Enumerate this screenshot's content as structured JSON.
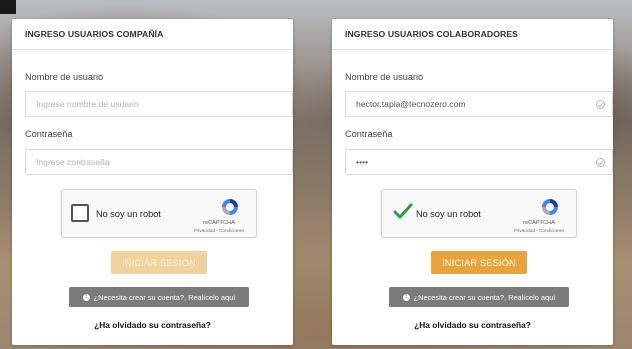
{
  "corner_badge": "",
  "company_panel": {
    "title": "INGRESO USUARIOS COMPAÑÍA",
    "username_label": "Nombre de usuario",
    "username_placeholder": "Ingrese nombre de usuario",
    "username_value": "",
    "password_label": "Contraseña",
    "password_placeholder": "Ingrese contraseña",
    "password_value": "",
    "captcha_label": "No soy un robot",
    "captcha_checked": false,
    "captcha_brand": "reCAPTCHA",
    "captcha_terms": "Privacidad - Condiciones",
    "login_button": "INICIAR SESIÓN",
    "login_enabled": false,
    "signup_button": "¿Necesita crear su cuenta?, Realícelo aquí",
    "forgot_link": "¿Ha olvidado su contraseña?"
  },
  "collab_panel": {
    "title": "INGRESO USUARIOS COLABORADORES",
    "username_label": "Nombre de usuario",
    "username_placeholder": "Ingrese nombre de usuario",
    "username_value": "hector.tapia@tecnozero.com",
    "password_label": "Contraseña",
    "password_placeholder": "Ingrese contraseña",
    "password_value": "••••",
    "captcha_label": "No soy un robot",
    "captcha_checked": true,
    "captcha_brand": "reCAPTCHA",
    "captcha_terms": "Privacidad - Condiciones",
    "login_button": "INICIAR SESIÓN",
    "login_enabled": true,
    "signup_button": "¿Necesita crear su cuenta?, Realícelo aquí",
    "forgot_link": "¿Ha olvidado su contraseña?"
  },
  "colors": {
    "login_enabled": "#e8a33a",
    "login_disabled": "#f2d29c",
    "signup_bg": "#7b7b7b",
    "check_green": "#2e9c4a"
  },
  "icons": {
    "info": "info-circle-icon",
    "valid": "check-circle-icon",
    "captcha_logo": "recaptcha-logo-icon",
    "captcha_tick": "checkmark-icon"
  }
}
